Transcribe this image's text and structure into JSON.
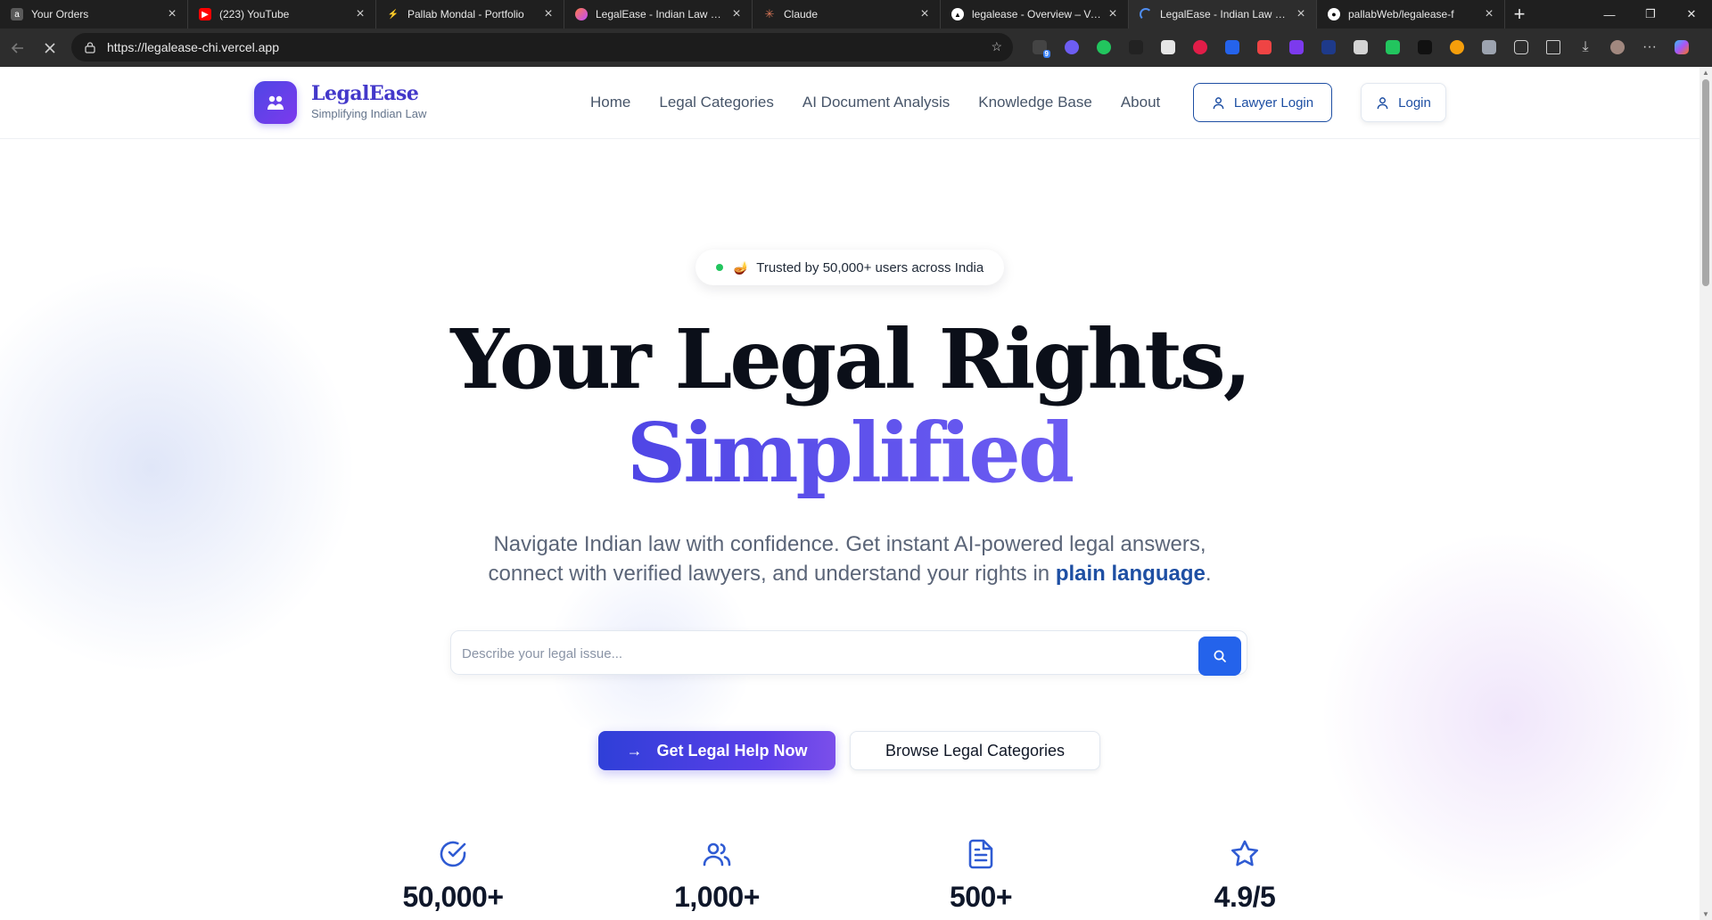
{
  "browser": {
    "tabs": [
      {
        "title": "Your Orders",
        "favicon": "amazon-icon",
        "color": "#5a5a5a",
        "active": false
      },
      {
        "title": "(223) YouTube",
        "favicon": "youtube-icon",
        "color": "#ff0000",
        "active": false
      },
      {
        "title": "Pallab Mondal - Portfolio",
        "favicon": "bolt-icon",
        "color": "#3a3a3a",
        "active": false
      },
      {
        "title": "LegalEase - Indian Law Made",
        "favicon": "lovable-icon",
        "color": "#ff5a8a",
        "active": false
      },
      {
        "title": "Claude",
        "favicon": "claude-icon",
        "color": "#d97757",
        "active": false
      },
      {
        "title": "legalease - Overview – Vercel",
        "favicon": "vercel-icon",
        "color": "#ffffff",
        "active": false
      },
      {
        "title": "LegalEase - Indian Law Made",
        "favicon": "loading-icon",
        "color": "#4f8df0",
        "active": true
      },
      {
        "title": "pallabWeb/legalease-f",
        "favicon": "github-icon",
        "color": "#ffffff",
        "active": false
      }
    ],
    "url": "https://legalease-chi.vercel.app",
    "extension_badge": "9"
  },
  "site": {
    "brand_name": "LegalEase",
    "brand_tagline": "Simplifying Indian Law",
    "nav": [
      "Home",
      "Legal Categories",
      "AI Document Analysis",
      "Knowledge Base",
      "About"
    ],
    "lawyer_login": "Lawyer Login",
    "login": "Login"
  },
  "hero": {
    "trusted_badge": "Trusted by 50,000+ users across India",
    "title_line1": "Your Legal Rights,",
    "title_line2": "Simplified",
    "sub_line1": "Navigate Indian law with confidence. Get instant AI-powered legal answers,",
    "sub_line2_pre": "connect with verified lawyers, and understand your rights in ",
    "sub_line2_hl": "plain language",
    "sub_line2_post": ".",
    "search_placeholder": "Describe your legal issue...",
    "cta_primary": "Get Legal Help Now",
    "cta_secondary": "Browse Legal Categories"
  },
  "stats": [
    {
      "icon": "check-circle-icon",
      "value": "50,000+"
    },
    {
      "icon": "users-icon",
      "value": "1,000+"
    },
    {
      "icon": "document-icon",
      "value": "500+"
    },
    {
      "icon": "star-icon",
      "value": "4.9/5"
    }
  ],
  "colors": {
    "accent": "#4f46e5",
    "link": "#1e4fa3",
    "search_button": "#2463eb"
  }
}
